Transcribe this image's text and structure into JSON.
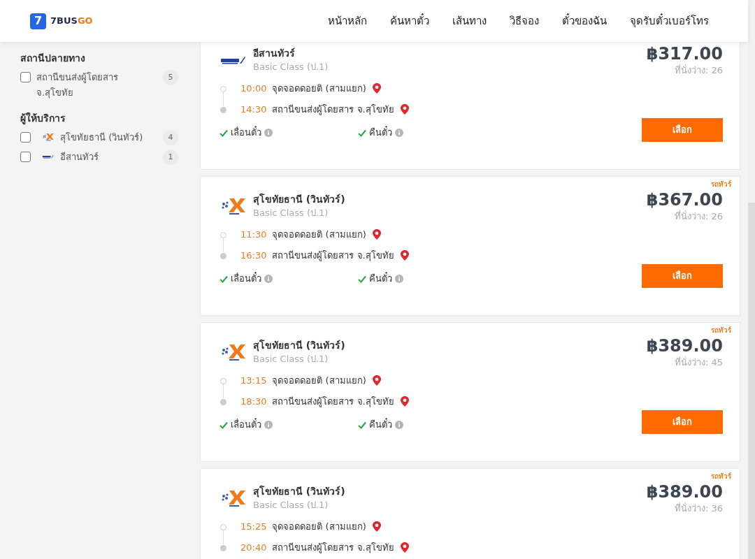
{
  "header": {
    "logo": {
      "digit": "7",
      "brand_a": "7BUS",
      "brand_b": "GO"
    },
    "nav": [
      "หน้าหลัก",
      "ค้นหาตั๋ว",
      "เส้นทาง",
      "วิธีจอง",
      "ตั๋วของฉัน",
      "จุดรับตั๋วเบอร์โทร"
    ]
  },
  "sidebar": {
    "sections": [
      {
        "title": "สถานีปลายทาง",
        "items": [
          {
            "label": "สถานีขนส่งผู้โดยสาร จ.สุโขทัย",
            "count": "5",
            "checked": false
          }
        ]
      },
      {
        "title": "ผู้ให้บริการ",
        "items": [
          {
            "label": "สุโขทัยธานี (วินทัวร์)",
            "count": "4",
            "checked": false,
            "kind": "sukhothai"
          },
          {
            "label": "อีสานทัวร์",
            "count": "1",
            "checked": false,
            "kind": "isan"
          }
        ]
      }
    ]
  },
  "trips": [
    {
      "kind": "isan",
      "operator": "อีสานทัวร์",
      "class": "Basic Class (ป.1)",
      "price": "฿317.00",
      "seats": "ที่นั่งว่าง: 26",
      "stops": [
        {
          "time": "10:00",
          "place": "จุดจอดดอยติ (สามแยก)",
          "kind": "departure"
        },
        {
          "time": "14:30",
          "place": "สถานีขนส่งผู้โดยสาร จ.สุโขทัย",
          "kind": "arrival"
        }
      ],
      "features": [
        {
          "label": "เลื่อนตั๋ว",
          "available": true
        },
        {
          "label": "คืนตั๋ว",
          "available": true
        }
      ],
      "button": "เลือก"
    },
    {
      "kind": "sukhothai",
      "badge": "รถทัวร์",
      "operator": "สุโขทัยธานี (วินทัวร์)",
      "class": "Basic Class (ป.1)",
      "price": "฿367.00",
      "seats": "ที่นั่งว่าง: 26",
      "stops": [
        {
          "time": "11:30",
          "place": "จุดจอดดอยติ (สามแยก)",
          "kind": "departure"
        },
        {
          "time": "16:30",
          "place": "สถานีขนส่งผู้โดยสาร จ.สุโขทัย",
          "kind": "arrival"
        }
      ],
      "features": [
        {
          "label": "เลื่อนตั๋ว",
          "available": true
        },
        {
          "label": "คืนตั๋ว",
          "available": true
        }
      ],
      "button": "เลือก"
    },
    {
      "kind": "sukhothai",
      "badge": "รถทัวร์",
      "operator": "สุโขทัยธานี (วินทัวร์)",
      "class": "Basic Class (ป.1)",
      "price": "฿389.00",
      "seats": "ที่นั่งว่าง: 45",
      "stops": [
        {
          "time": "13:15",
          "place": "จุดจอดดอยติ (สามแยก)",
          "kind": "departure"
        },
        {
          "time": "18:30",
          "place": "สถานีขนส่งผู้โดยสาร จ.สุโขทัย",
          "kind": "arrival"
        }
      ],
      "features": [
        {
          "label": "เลื่อนตั๋ว",
          "available": true
        },
        {
          "label": "คืนตั๋ว",
          "available": true
        }
      ],
      "button": "เลือก"
    },
    {
      "kind": "sukhothai",
      "badge": "รถทัวร์",
      "operator": "สุโขทัยธานี (วินทัวร์)",
      "class": "Basic Class (ป.1)",
      "price": "฿389.00",
      "seats": "ที่นั่งว่าง: 36",
      "stops": [
        {
          "time": "15:25",
          "place": "จุดจอดดอยติ (สามแยก)",
          "kind": "departure"
        },
        {
          "time": "20:40",
          "place": "สถานีขนส่งผู้โดยสาร จ.สุโขทัย",
          "kind": "arrival"
        }
      ]
    }
  ]
}
